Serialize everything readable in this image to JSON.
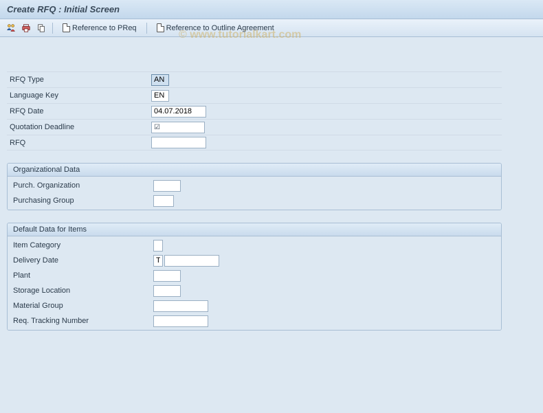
{
  "title": "Create RFQ : Initial Screen",
  "toolbar": {
    "ref_preq_label": "Reference to PReq",
    "ref_outline_label": "Reference to Outline Agreement"
  },
  "watermark": "© www.tutorialkart.com",
  "main_fields": {
    "rfq_type": {
      "label": "RFQ Type",
      "value": "AN"
    },
    "language_key": {
      "label": "Language Key",
      "value": "EN"
    },
    "rfq_date": {
      "label": "RFQ Date",
      "value": "04.07.2018"
    },
    "quotation_deadline": {
      "label": "Quotation Deadline",
      "value": "",
      "required_marker": "☑"
    },
    "rfq": {
      "label": "RFQ",
      "value": ""
    }
  },
  "org_data": {
    "header": "Organizational Data",
    "purch_org": {
      "label": "Purch. Organization",
      "value": ""
    },
    "purch_group": {
      "label": "Purchasing Group",
      "value": ""
    }
  },
  "default_items": {
    "header": "Default Data for Items",
    "item_category": {
      "label": "Item Category",
      "value": ""
    },
    "delivery_date": {
      "label": "Delivery Date",
      "value_cat": "T",
      "value_date": ""
    },
    "plant": {
      "label": "Plant",
      "value": ""
    },
    "storage_location": {
      "label": "Storage Location",
      "value": ""
    },
    "material_group": {
      "label": "Material Group",
      "value": ""
    },
    "req_tracking_number": {
      "label": "Req. Tracking Number",
      "value": ""
    }
  }
}
